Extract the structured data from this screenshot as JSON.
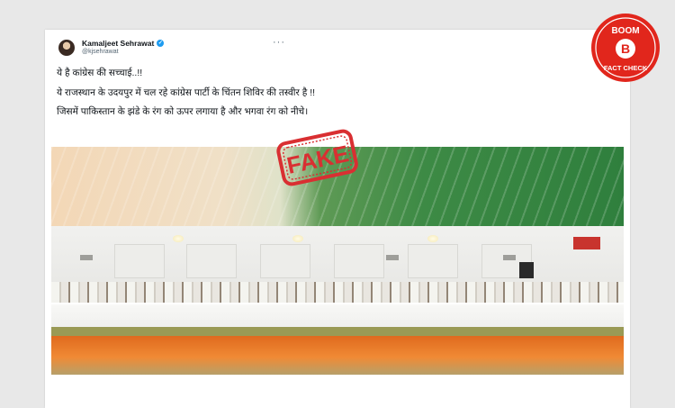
{
  "tweet": {
    "author_name": "Kamaljeet Sehrawat",
    "handle": "@kjsehrawat",
    "more_label": "···",
    "paragraphs": [
      "ये है कांग्रेस की सच्चाई..!!",
      "ये राजस्थान के उदयपुर में चल रहे कांग्रेस पार्टी के चिंतन शिविर की तस्वीर है !!",
      "जिसमें पाकिस्तान के झंडे के रंग को ऊपर लगाया है और भगवा रंग को नीचे।"
    ]
  },
  "stamp": {
    "label": "FAKE",
    "color": "#d92f32"
  },
  "logo": {
    "top_text": "BOOM",
    "letter": "B",
    "bottom_text": "FACT CHECK",
    "color": "#e1261c"
  }
}
